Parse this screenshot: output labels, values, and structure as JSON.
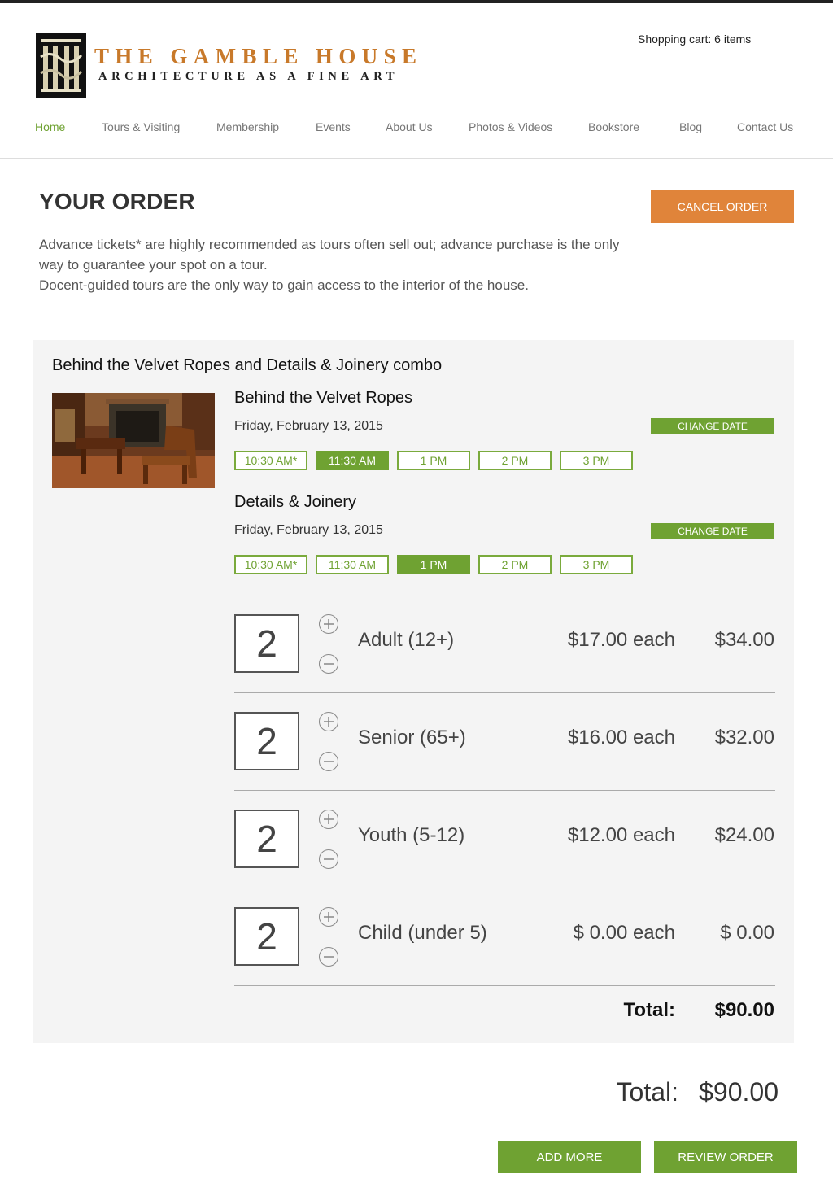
{
  "header": {
    "brand_title": "THE GAMBLE HOUSE",
    "brand_subtitle": "ARCHITECTURE AS A FINE ART",
    "cart_label": "Shopping cart: 6 items"
  },
  "nav": {
    "items": [
      {
        "label": "Home",
        "active": true
      },
      {
        "label": "Tours & Visiting"
      },
      {
        "label": "Membership"
      },
      {
        "label": "Events"
      },
      {
        "label": "About Us"
      },
      {
        "label": "Photos & Videos"
      },
      {
        "label": "Bookstore"
      },
      {
        "label": "Blog"
      },
      {
        "label": "Contact Us"
      }
    ]
  },
  "order": {
    "title": "YOUR ORDER",
    "cancel_label": "CANCEL ORDER",
    "intro_line1": "Advance tickets* are highly recommended as tours often sell out; advance purchase is the only way to guarantee your spot on a tour.",
    "intro_line2": "Docent-guided tours are the only way to gain access to the interior of the house."
  },
  "combo": {
    "title": "Behind the Velvet Ropes and Details & Joinery combo",
    "tours": [
      {
        "name": "Behind the Velvet Ropes",
        "date": "Friday, February 13, 2015",
        "change_date_label": "CHANGE DATE",
        "slots": [
          "10:30 AM*",
          "11:30 AM",
          "1 PM",
          "2 PM",
          "3 PM"
        ],
        "selected_slot": "11:30 AM"
      },
      {
        "name": "Details & Joinery",
        "date": "Friday, February 13, 2015",
        "change_date_label": "CHANGE DATE",
        "slots": [
          "10:30 AM*",
          "11:30 AM",
          "1 PM",
          "2 PM",
          "3 PM"
        ],
        "selected_slot": "1 PM"
      }
    ],
    "tickets": [
      {
        "qty": "2",
        "label": "Adult  (12+)",
        "each": "$17.00 each",
        "subtotal": "$34.00"
      },
      {
        "qty": "2",
        "label": "Senior  (65+)",
        "each": "$16.00 each",
        "subtotal": "$32.00"
      },
      {
        "qty": "2",
        "label": "Youth  (5-12)",
        "each": "$12.00 each",
        "subtotal": "$24.00"
      },
      {
        "qty": "2",
        "label": "Child  (under 5)",
        "each": "$ 0.00 each",
        "subtotal": "$ 0.00"
      }
    ],
    "total_label": "Total:",
    "total_value": "$90.00"
  },
  "summary": {
    "total_label": "Total:",
    "total_value": "$90.00",
    "add_more_label": "ADD MORE",
    "review_label": "REVIEW ORDER"
  },
  "colors": {
    "accent_green": "#6fa232",
    "accent_orange": "#e0843a",
    "brand_orange": "#c8792a"
  }
}
